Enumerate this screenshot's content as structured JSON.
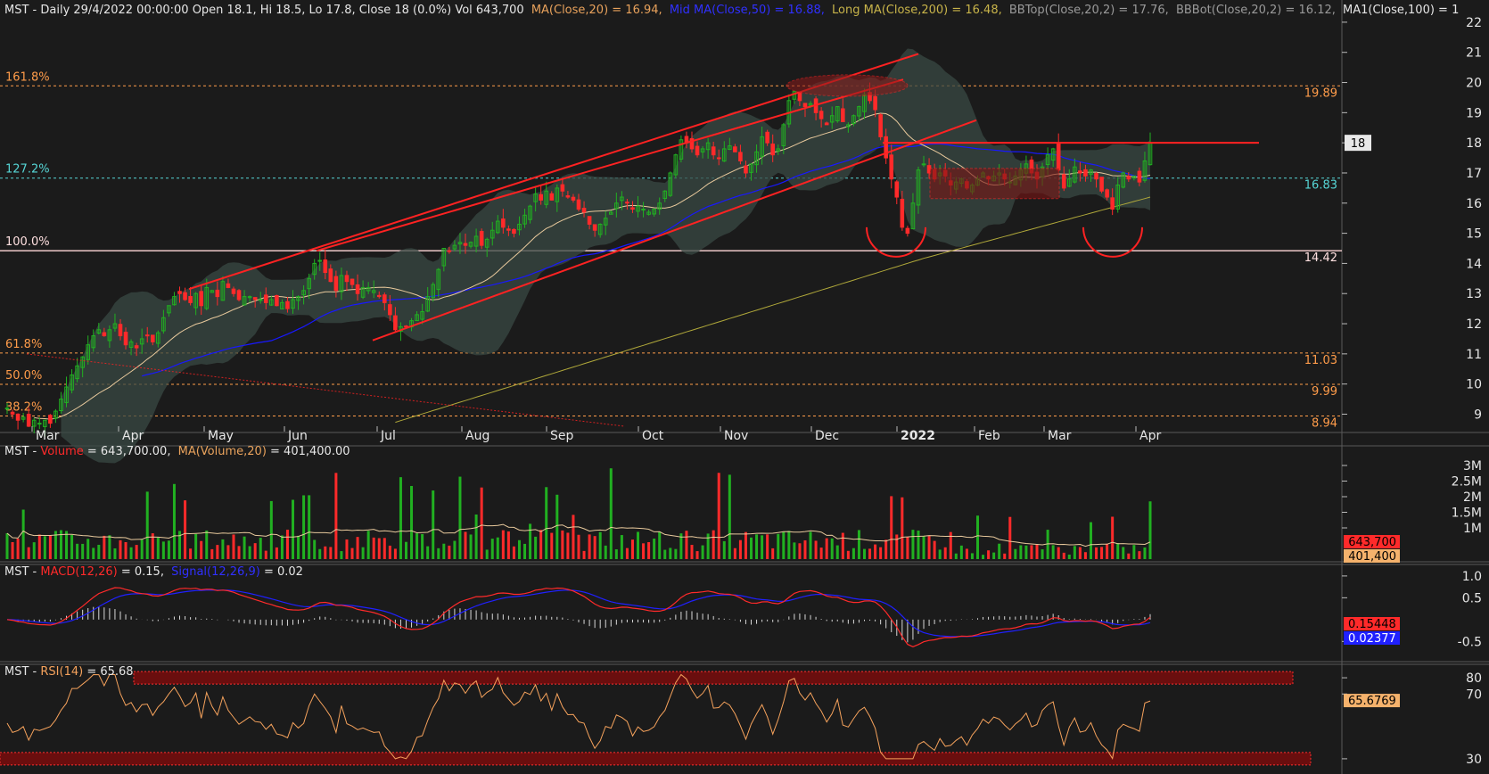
{
  "chart_data": [
    {
      "type": "candlestick",
      "panel": "price",
      "header": {
        "symbol": "MST",
        "text": "MST - Daily 29/4/2022 00:00:00 Open 18.1, Hi 18.5, Lo 17.8, Close 18 (0.0%) Vol 643,700",
        "ma20": "MA(Close,20) = 16.94,",
        "ma50": "Mid MA(Close,50) = 16.88,",
        "ma200": "Long MA(Close,200) = 16.48,",
        "bbtop": "BBTop(Close,20,2) = 17.76,",
        "bbbot": "BBBot(Close,20,2) = 16.12,",
        "ma100": "MA1(Close,100) = 1"
      },
      "y_ticks": [
        9,
        10,
        11,
        12,
        13,
        14,
        15,
        16,
        17,
        18,
        19,
        20,
        21,
        22
      ],
      "ylim": [
        8.6,
        22.5
      ],
      "months": [
        "Mar",
        "Apr",
        "May",
        "Jun",
        "Jul",
        "Aug",
        "Sep",
        "Oct",
        "Nov",
        "Dec",
        "2022",
        "Feb",
        "Mar",
        "Apr"
      ],
      "last_price_label": "18",
      "fib_levels": [
        {
          "pct": "161.8%",
          "value": 19.89,
          "label": "19.89"
        },
        {
          "pct": "127.2%",
          "value": 16.83,
          "label": "16.83"
        },
        {
          "pct": "100.0%",
          "value": 14.42,
          "label": "14.42"
        },
        {
          "pct": "61.8%",
          "value": 11.03,
          "label": "11.03"
        },
        {
          "pct": "50.0%",
          "value": 9.99,
          "label": "9.99"
        },
        {
          "pct": "38.2%",
          "value": 8.94,
          "label": "8.94"
        }
      ],
      "ohlc_close_path": [
        9.2,
        9.0,
        8.8,
        8.9,
        8.6,
        8.8,
        8.7,
        8.8,
        8.7,
        9.1,
        9.5,
        9.9,
        10.3,
        10.6,
        10.9,
        11.3,
        11.6,
        11.8,
        11.6,
        11.8,
        12.0,
        11.6,
        11.3,
        11.4,
        11.2,
        11.5,
        11.6,
        11.4,
        11.7,
        12.2,
        12.6,
        12.9,
        13.0,
        12.8,
        12.7,
        13.0,
        12.6,
        13.2,
        13.1,
        12.9,
        13.4,
        13.2,
        13.0,
        12.8,
        12.9,
        12.9,
        12.8,
        12.8,
        12.7,
        12.8,
        12.6,
        12.7,
        12.5,
        12.8,
        12.9,
        13.1,
        13.5,
        14.0,
        14.1,
        13.7,
        13.4,
        13.1,
        13.6,
        13.4,
        13.3,
        13.0,
        13.2,
        13.2,
        13.1,
        12.9,
        12.7,
        12.3,
        11.8,
        11.9,
        11.9,
        12.1,
        12.3,
        12.4,
        12.9,
        13.3,
        13.8,
        14.5,
        14.4,
        14.6,
        14.7,
        14.6,
        14.7,
        14.9,
        14.6,
        14.8,
        15.1,
        15.4,
        15.2,
        15.1,
        15.0,
        15.3,
        15.6,
        15.9,
        16.3,
        16.1,
        16.4,
        16.1,
        16.5,
        16.4,
        16.2,
        16.1,
        15.8,
        15.7,
        15.3,
        15.1,
        15.3,
        15.5,
        15.7,
        16.0,
        16.2,
        16.0,
        15.8,
        15.9,
        15.8,
        15.7,
        15.8,
        16.0,
        16.4,
        17.0,
        17.6,
        18.1,
        18.0,
        17.8,
        17.6,
        17.8,
        18.0,
        17.6,
        17.5,
        17.8,
        17.9,
        17.7,
        17.4,
        17.0,
        17.3,
        17.7,
        18.2,
        18.0,
        17.6,
        17.8,
        18.6,
        19.4,
        19.7,
        19.4,
        19.2,
        19.3,
        19.0,
        18.8,
        18.6,
        18.9,
        19.2,
        18.7,
        18.6,
        18.9,
        19.2,
        19.6,
        19.4,
        19.1,
        18.2,
        17.5,
        16.8,
        16.2,
        15.2,
        15.0,
        16.0,
        17.1,
        17.3,
        17.0,
        16.8,
        17.0,
        16.9,
        16.6,
        16.7,
        16.8,
        16.5,
        16.6,
        16.8,
        17.0,
        16.8,
        16.9,
        17.0,
        16.8,
        16.7,
        16.9,
        17.1,
        17.3,
        17.0,
        16.8,
        17.2,
        17.6,
        17.8,
        17.1,
        16.5,
        16.8,
        17.2,
        17.0,
        16.9,
        17.1,
        16.8,
        16.4,
        16.2,
        15.8,
        16.6,
        17.0,
        16.8,
        16.9,
        16.7,
        17.4,
        18.0
      ]
    },
    {
      "type": "bar",
      "panel": "volume",
      "header": {
        "symbol": "MST - ",
        "name": "Volume",
        "value": " = 643,700.00,",
        "ma_name": "MA(Volume,20)",
        "ma_value": " = 401,400.00"
      },
      "y_ticks": [
        "1M",
        "1.5M",
        "2M",
        "2.5M",
        "3M"
      ],
      "last_value_label": "643,700",
      "last_ma_label": "401,400"
    },
    {
      "type": "line",
      "panel": "macd",
      "header": {
        "symbol": "MST - ",
        "macd_name": "MACD(12,26)",
        "macd_value": " = 0.15,",
        "signal_name": "Signal(12,26,9)",
        "signal_value": " = 0.02"
      },
      "y_ticks": [
        "1.0",
        "0.5",
        "-0.5"
      ],
      "last_macd_label": "0.15448",
      "last_signal_label": "0.02377"
    },
    {
      "type": "line",
      "panel": "rsi",
      "header": {
        "symbol": "MST - ",
        "name": "RSI(14)",
        "value": " = 65.68"
      },
      "y_ticks": [
        "80",
        "70",
        "30"
      ],
      "last_value_label": "65.6769"
    }
  ],
  "colors": {
    "background": "#1b1b1b",
    "up": "#21b021",
    "down": "#ff2a2a",
    "ma20": "#e8c99c",
    "ma50": "#1818ff",
    "ma200": "#b0a83a",
    "bollinger_fill": "#3a4a44",
    "trendline": "#ff2222",
    "fib_orange": "#ff9c4a",
    "fib_cyan": "#56d6d6",
    "rsi": "#f5a25c",
    "macd": "#ff2a2a",
    "signal": "#2020ff"
  }
}
